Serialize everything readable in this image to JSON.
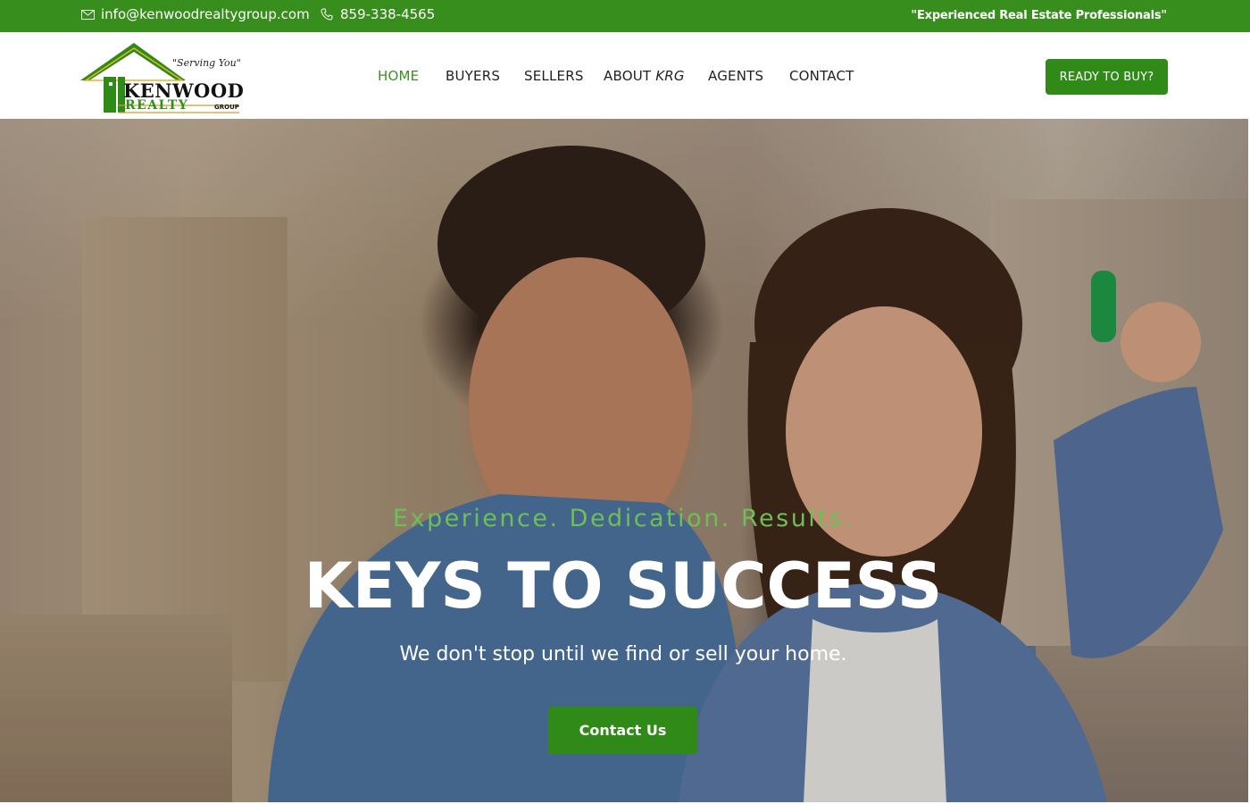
{
  "topbar": {
    "email": "info@kenwoodrealtygroup.com",
    "phone": "859-338-4565",
    "tagline": "\"Experienced Real Estate Professionals\"",
    "email_icon": "envelope-icon",
    "phone_icon": "phone-icon"
  },
  "logo": {
    "serving": "\"Serving You\"",
    "line1": "KENWOOD",
    "line2": "REALTY",
    "line3": "GROUP"
  },
  "nav": {
    "items": [
      {
        "label": "HOME",
        "active": true
      },
      {
        "label": "BUYERS"
      },
      {
        "label": "SELLERS"
      },
      {
        "label": "ABOUT",
        "suffix": "KRG"
      },
      {
        "label": "AGENTS"
      },
      {
        "label": "CONTACT"
      }
    ],
    "cta": "READY TO BUY?"
  },
  "hero": {
    "subtitle": "Experience. Dedication. Results.",
    "title": "KEYS TO SUCCESS",
    "description": "We don't stop until we find or sell your home.",
    "button": "Contact Us"
  },
  "colors": {
    "brand_green": "#388e1c",
    "button_green": "#2f8a17",
    "accent_light_green": "#6dbf57"
  }
}
